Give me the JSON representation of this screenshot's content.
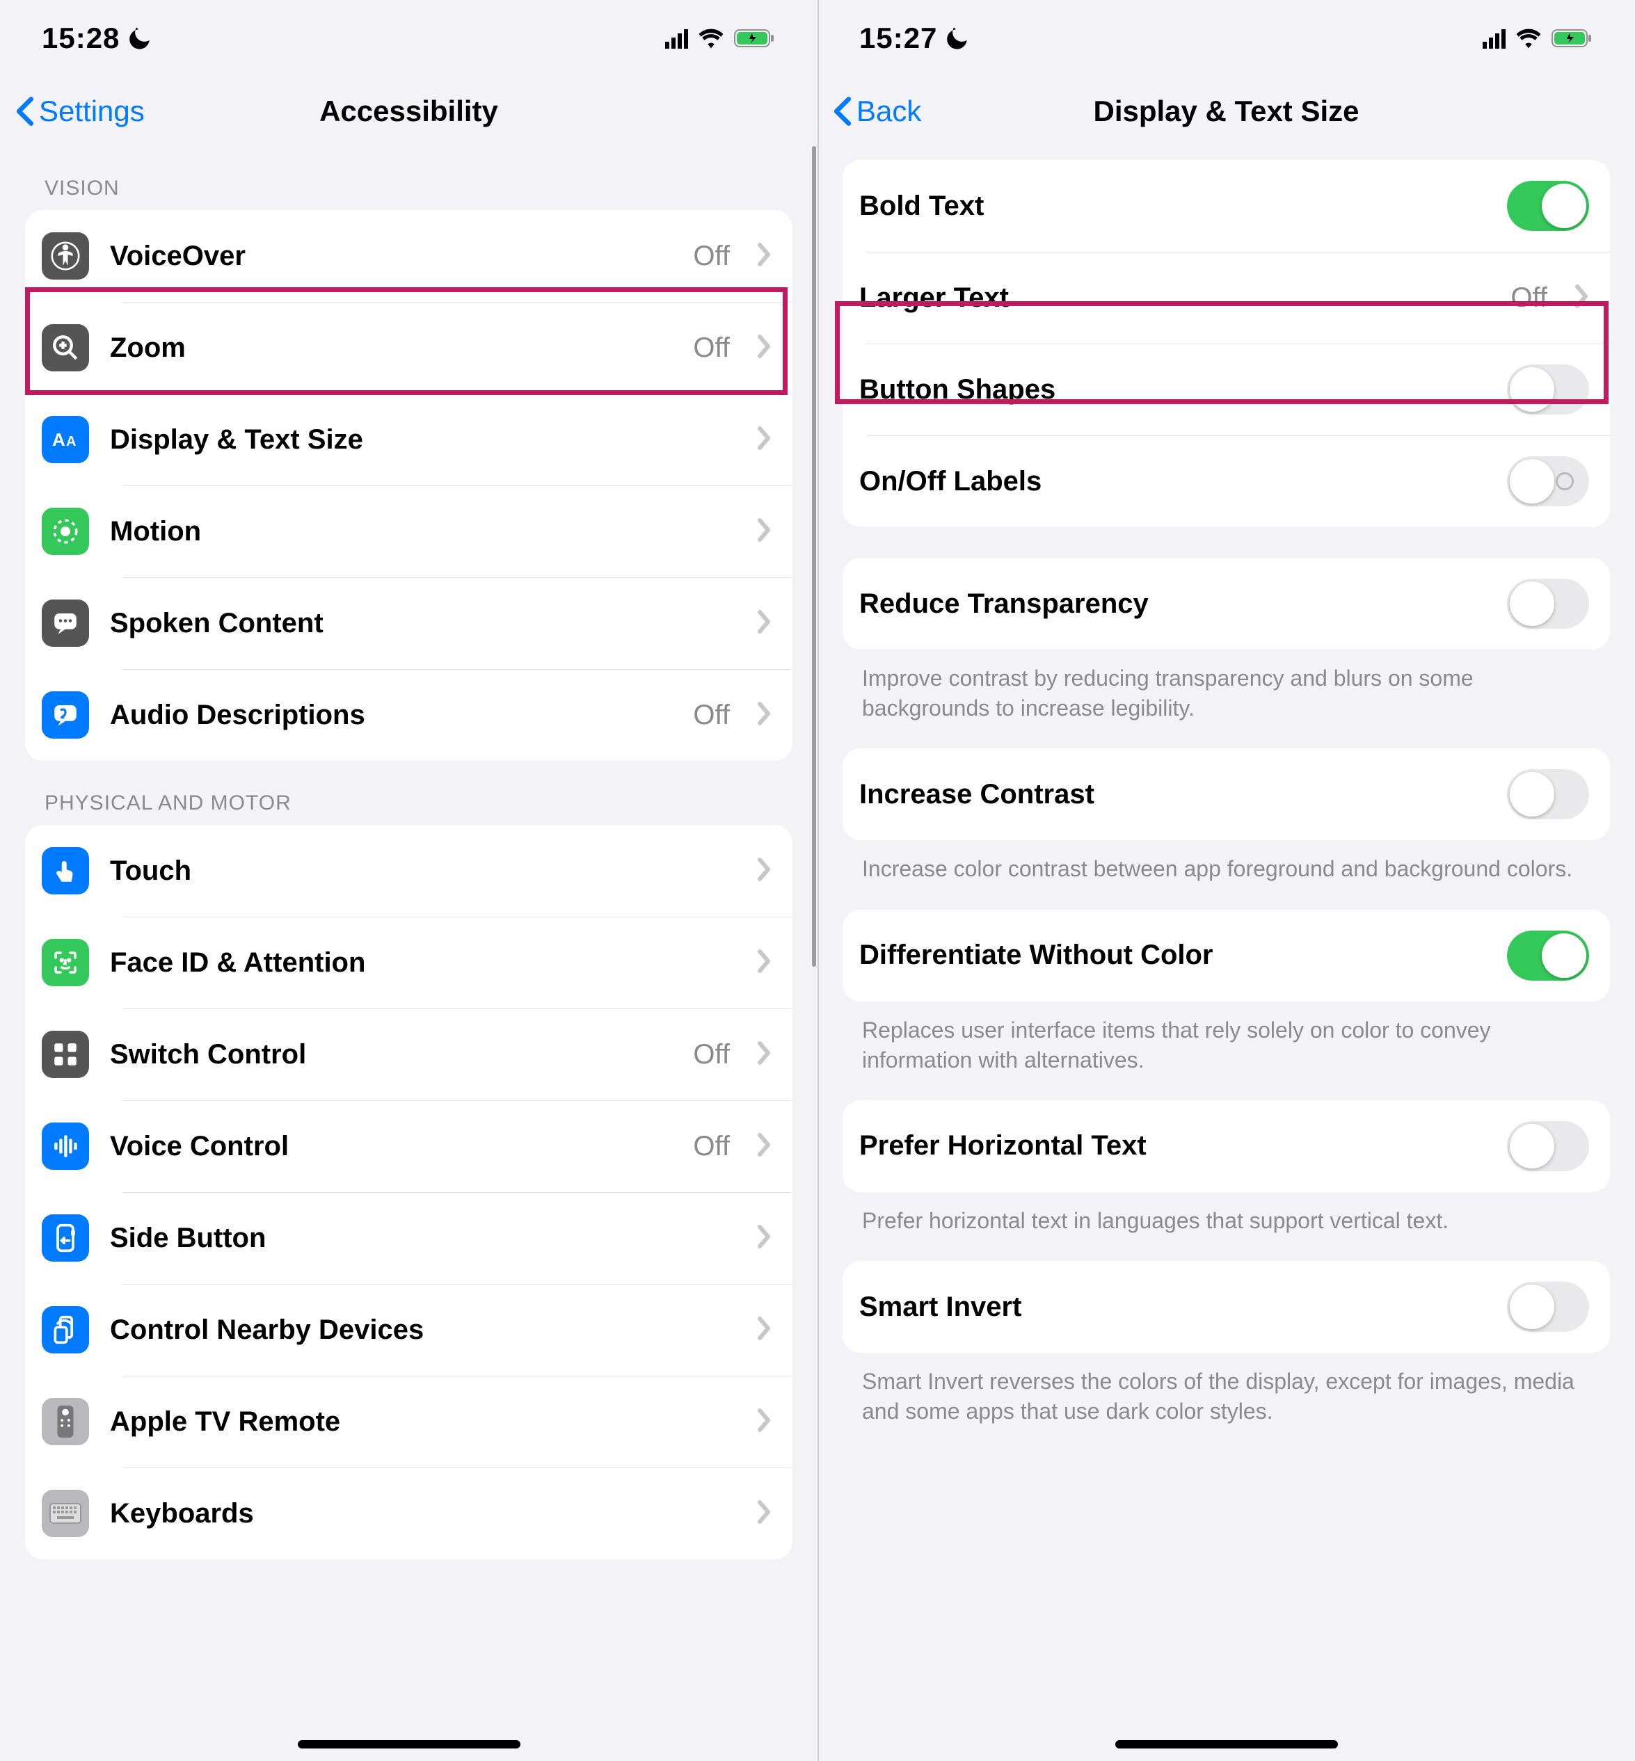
{
  "left": {
    "status": {
      "time": "15:28"
    },
    "nav": {
      "back": "Settings",
      "title": "Accessibility"
    },
    "sections": [
      {
        "header": "VISION",
        "rows": [
          {
            "icon": "voiceover",
            "bg": "bg-dark",
            "label": "VoiceOver",
            "val": "Off",
            "chev": true
          },
          {
            "icon": "zoom",
            "bg": "bg-dark",
            "label": "Zoom",
            "val": "Off",
            "chev": true
          },
          {
            "icon": "textsize",
            "bg": "bg-blue",
            "label": "Display & Text Size",
            "val": "",
            "chev": true
          },
          {
            "icon": "motion",
            "bg": "bg-green",
            "label": "Motion",
            "val": "",
            "chev": true
          },
          {
            "icon": "spoken",
            "bg": "bg-dark",
            "label": "Spoken Content",
            "val": "",
            "chev": true
          },
          {
            "icon": "audio",
            "bg": "bg-blue",
            "label": "Audio Descriptions",
            "val": "Off",
            "chev": true
          }
        ]
      },
      {
        "header": "PHYSICAL AND MOTOR",
        "rows": [
          {
            "icon": "touch",
            "bg": "bg-blue",
            "label": "Touch",
            "val": "",
            "chev": true
          },
          {
            "icon": "faceid",
            "bg": "bg-green",
            "label": "Face ID & Attention",
            "val": "",
            "chev": true
          },
          {
            "icon": "switch",
            "bg": "bg-dark",
            "label": "Switch Control",
            "val": "Off",
            "chev": true
          },
          {
            "icon": "voicectrl",
            "bg": "bg-blue",
            "label": "Voice Control",
            "val": "Off",
            "chev": true
          },
          {
            "icon": "sidebtn",
            "bg": "bg-blue",
            "label": "Side Button",
            "val": "",
            "chev": true
          },
          {
            "icon": "nearby",
            "bg": "bg-blue",
            "label": "Control Nearby Devices",
            "val": "",
            "chev": true
          },
          {
            "icon": "tvremote",
            "bg": "bg-grey",
            "label": "Apple TV Remote",
            "val": "",
            "chev": true
          },
          {
            "icon": "keyboard",
            "bg": "bg-grey",
            "label": "Keyboards",
            "val": "",
            "chev": true
          }
        ]
      }
    ]
  },
  "right": {
    "status": {
      "time": "15:27"
    },
    "nav": {
      "back": "Back",
      "title": "Display & Text Size"
    },
    "groups": [
      {
        "rows": [
          {
            "label": "Bold Text",
            "type": "toggle",
            "on": true
          },
          {
            "label": "Larger Text",
            "type": "link",
            "val": "Off"
          },
          {
            "label": "Button Shapes",
            "type": "toggle",
            "on": false
          },
          {
            "label": "On/Off Labels",
            "type": "toggle-labels",
            "on": false
          }
        ],
        "footer": ""
      },
      {
        "rows": [
          {
            "label": "Reduce Transparency",
            "type": "toggle",
            "on": false
          }
        ],
        "footer": "Improve contrast by reducing transparency and blurs on some backgrounds to increase legibility."
      },
      {
        "rows": [
          {
            "label": "Increase Contrast",
            "type": "toggle",
            "on": false
          }
        ],
        "footer": "Increase color contrast between app foreground and background colors."
      },
      {
        "rows": [
          {
            "label": "Differentiate Without Color",
            "type": "toggle",
            "on": true
          }
        ],
        "footer": "Replaces user interface items that rely solely on color to convey information with alternatives."
      },
      {
        "rows": [
          {
            "label": "Prefer Horizontal Text",
            "type": "toggle",
            "on": false
          }
        ],
        "footer": "Prefer horizontal text in languages that support vertical text."
      },
      {
        "rows": [
          {
            "label": "Smart Invert",
            "type": "toggle",
            "on": false
          }
        ],
        "footer": "Smart Invert reverses the colors of the display, except for images, media and some apps that use dark color styles."
      }
    ]
  }
}
